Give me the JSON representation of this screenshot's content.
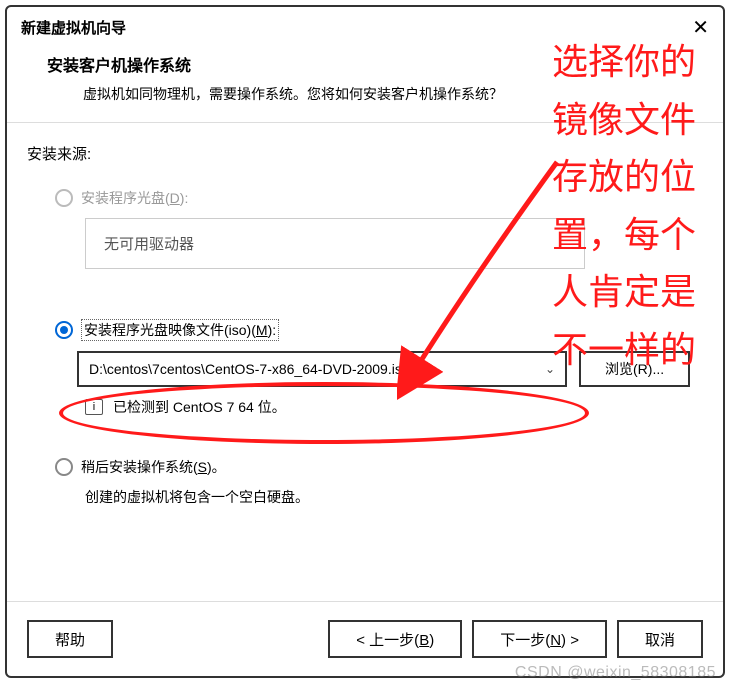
{
  "window": {
    "title": "新建虚拟机向导"
  },
  "header": {
    "title": "安装客户机操作系统",
    "subtitle": "虚拟机如同物理机，需要操作系统。您将如何安装客户机操作系统？"
  },
  "source": {
    "label": "安装来源:",
    "option_disc": {
      "label_pre": "安装程序光盘(",
      "key": "D",
      "label_post": "):"
    },
    "no_drive": "无可用驱动器",
    "option_iso": {
      "label_pre": "安装程序光盘映像文件(iso)(",
      "key": "M",
      "label_post": "):"
    },
    "iso_path": "D:\\centos\\7centos\\CentOS-7-x86_64-DVD-2009.iso",
    "browse_pre": "浏览(",
    "browse_key": "R",
    "browse_post": ")...",
    "detected": "已检测到 CentOS 7 64 位。",
    "option_later": {
      "label_pre": "稍后安装操作系统(",
      "key": "S",
      "label_post": ")。"
    },
    "later_note": "创建的虚拟机将包含一个空白硬盘。"
  },
  "footer": {
    "help": "帮助",
    "back_pre": "< 上一步(",
    "back_key": "B",
    "back_post": ")",
    "next_pre": "下一步(",
    "next_key": "N",
    "next_post": ") >",
    "cancel": "取消"
  },
  "annotation": {
    "text": "选择你的镜像文件存放的位置，每个人肯定是不一样的"
  },
  "watermark": "CSDN @weixin_58308185"
}
